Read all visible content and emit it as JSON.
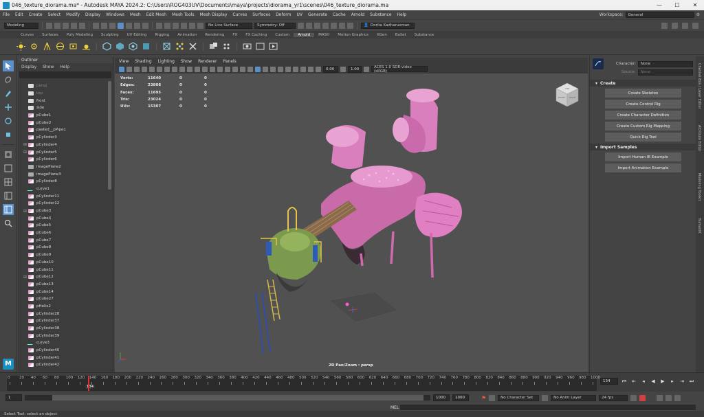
{
  "window": {
    "title": "046_texture_diorama.ma* - Autodesk MAYA 2024.2: C:\\Users\\ROG403UV\\Documents\\maya\\projects\\diorama_yr1\\scenes\\046_texture_diorama.ma",
    "minimize": "—",
    "maximize": "☐",
    "close": "✕"
  },
  "menu": {
    "items": [
      "File",
      "Edit",
      "Create",
      "Select",
      "Modify",
      "Display",
      "Windows",
      "Mesh",
      "Edit Mesh",
      "Mesh Tools",
      "Mesh Display",
      "Curves",
      "Surfaces",
      "Deform",
      "UV",
      "Generate",
      "Cache",
      "Arnold",
      "Substance",
      "Help"
    ],
    "workspace_label": "Workspace:",
    "workspace_value": "General"
  },
  "statusline": {
    "mode": "Modeling",
    "live_surface": "No Live Surface",
    "symmetry": "Symmetry: Off",
    "user": "Dorita Kadharusman"
  },
  "shelf": {
    "tabs": [
      "Curves",
      "Surfaces",
      "Poly Modeling",
      "Sculpting",
      "UV Editing",
      "Rigging",
      "Animation",
      "Rendering",
      "FX",
      "FX Caching",
      "Custom",
      "Arnold",
      "MASH",
      "Motion Graphics",
      "XGen",
      "Bullet",
      "Substance"
    ],
    "active_tab": "Arnold"
  },
  "outliner": {
    "title": "Outliner",
    "menu": [
      "Display",
      "Show",
      "Help"
    ],
    "items": [
      {
        "label": "persp",
        "icon": "cam",
        "dim": true,
        "plus": false
      },
      {
        "label": "top",
        "icon": "cam",
        "dim": true,
        "plus": false
      },
      {
        "label": "front",
        "icon": "cam",
        "dim": false,
        "plus": false
      },
      {
        "label": "side",
        "icon": "cam",
        "dim": false,
        "plus": false
      },
      {
        "label": "pCube1",
        "icon": "mesh",
        "dim": false,
        "plus": false
      },
      {
        "label": "pCube2",
        "icon": "mesh",
        "dim": false,
        "plus": false
      },
      {
        "label": "pasted__pPipe1",
        "icon": "mesh",
        "dim": false,
        "plus": false
      },
      {
        "label": "pCylinder3",
        "icon": "mesh",
        "dim": false,
        "plus": false
      },
      {
        "label": "pCylinder4",
        "icon": "mesh",
        "dim": false,
        "plus": true
      },
      {
        "label": "pCylinder5",
        "icon": "mesh",
        "dim": false,
        "plus": true
      },
      {
        "label": "pCylinder6",
        "icon": "mesh",
        "dim": false,
        "plus": false
      },
      {
        "label": "imagePlane2",
        "icon": "img",
        "dim": false,
        "plus": false
      },
      {
        "label": "imagePlane3",
        "icon": "img",
        "dim": false,
        "plus": false
      },
      {
        "label": "pCylinder8",
        "icon": "mesh",
        "dim": false,
        "plus": false
      },
      {
        "label": "curve1",
        "icon": "curve",
        "dim": false,
        "plus": false
      },
      {
        "label": "pCylinder11",
        "icon": "mesh",
        "dim": false,
        "plus": false
      },
      {
        "label": "pCylinder12",
        "icon": "mesh",
        "dim": false,
        "plus": false
      },
      {
        "label": "pCube3",
        "icon": "mesh",
        "dim": false,
        "plus": true
      },
      {
        "label": "pCube4",
        "icon": "mesh",
        "dim": false,
        "plus": false
      },
      {
        "label": "pCube5",
        "icon": "mesh",
        "dim": false,
        "plus": false
      },
      {
        "label": "pCube6",
        "icon": "mesh",
        "dim": false,
        "plus": false
      },
      {
        "label": "pCube7",
        "icon": "mesh",
        "dim": false,
        "plus": false
      },
      {
        "label": "pCube8",
        "icon": "mesh",
        "dim": false,
        "plus": false
      },
      {
        "label": "pCube9",
        "icon": "mesh",
        "dim": false,
        "plus": false
      },
      {
        "label": "pCube10",
        "icon": "mesh",
        "dim": false,
        "plus": false
      },
      {
        "label": "pCube11",
        "icon": "mesh",
        "dim": false,
        "plus": false
      },
      {
        "label": "pCube12",
        "icon": "mesh",
        "dim": false,
        "plus": true
      },
      {
        "label": "pCube13",
        "icon": "mesh",
        "dim": false,
        "plus": false
      },
      {
        "label": "pCube14",
        "icon": "mesh",
        "dim": false,
        "plus": false
      },
      {
        "label": "pCube27",
        "icon": "mesh",
        "dim": false,
        "plus": false
      },
      {
        "label": "pHelix2",
        "icon": "mesh",
        "dim": false,
        "plus": false
      },
      {
        "label": "pCylinder28",
        "icon": "mesh",
        "dim": false,
        "plus": false
      },
      {
        "label": "pCylinder37",
        "icon": "mesh",
        "dim": false,
        "plus": false
      },
      {
        "label": "pCylinder38",
        "icon": "mesh",
        "dim": false,
        "plus": false
      },
      {
        "label": "pCylinder39",
        "icon": "mesh",
        "dim": false,
        "plus": false
      },
      {
        "label": "curve3",
        "icon": "curve",
        "dim": false,
        "plus": false
      },
      {
        "label": "pCylinder40",
        "icon": "mesh",
        "dim": false,
        "plus": false
      },
      {
        "label": "pCylinder41",
        "icon": "mesh",
        "dim": false,
        "plus": false
      },
      {
        "label": "pCylinder42",
        "icon": "mesh",
        "dim": false,
        "plus": false
      }
    ]
  },
  "viewport": {
    "menu": [
      "View",
      "Shading",
      "Lighting",
      "Show",
      "Renderer",
      "Panels"
    ],
    "exposure": "0.00",
    "gamma": "1.00",
    "color_space": "ACES 1.0 SDR-video (sRGB)",
    "hud": [
      {
        "label": "Verts:",
        "v1": "11640",
        "v2": "0",
        "v3": "0"
      },
      {
        "label": "Edges:",
        "v1": "23808",
        "v2": "0",
        "v3": "0"
      },
      {
        "label": "Faces:",
        "v1": "11695",
        "v2": "0",
        "v3": "0"
      },
      {
        "label": "Tris:",
        "v1": "23024",
        "v2": "0",
        "v3": "0"
      },
      {
        "label": "UVs:",
        "v1": "15307",
        "v2": "0",
        "v3": "0"
      }
    ],
    "camera_label": "2D Pan/Zoom : persp",
    "viewcube": {
      "top": "TOP",
      "front": "FRONT",
      "right": "RIGHT"
    }
  },
  "humanik": {
    "character_label": "Character:",
    "character_value": "None",
    "source_label": "Source:",
    "source_value": "None",
    "create_section": "Create",
    "create_buttons": [
      "Create Skeleton",
      "Create Control Rig",
      "Create Character Definition",
      "Create Custom Rig Mapping",
      "Quick Rig Tool"
    ],
    "import_section": "Import Samples",
    "import_buttons": [
      "Import Human IK Example",
      "Import Animation Example"
    ]
  },
  "right_tabs": [
    "Channel Box / Layer Editor",
    "Attribute Editor",
    "Modeling Toolkit",
    "HumanIK"
  ],
  "timeline": {
    "ticks": [
      "0",
      "20",
      "40",
      "60",
      "80",
      "100",
      "120",
      "140",
      "160",
      "180",
      "200",
      "220",
      "240",
      "260",
      "280",
      "300",
      "320",
      "340",
      "360",
      "380",
      "400",
      "420",
      "440",
      "460",
      "480",
      "500",
      "520",
      "540",
      "560",
      "580",
      "600",
      "620",
      "640",
      "660",
      "680",
      "700",
      "720",
      "740",
      "760",
      "780",
      "800",
      "820",
      "840",
      "860",
      "880",
      "900",
      "920",
      "940",
      "960",
      "980",
      "1000"
    ],
    "current_frame": "134",
    "current_frame_box": "134",
    "start": "1",
    "end_inner": "1000",
    "end_outer": "1000",
    "character_set": "No Character Set",
    "anim_layer": "No Anim Layer",
    "fps": "24 fps"
  },
  "command": {
    "mel_label": "MEL",
    "help_text": "Select Tool: select an object"
  }
}
